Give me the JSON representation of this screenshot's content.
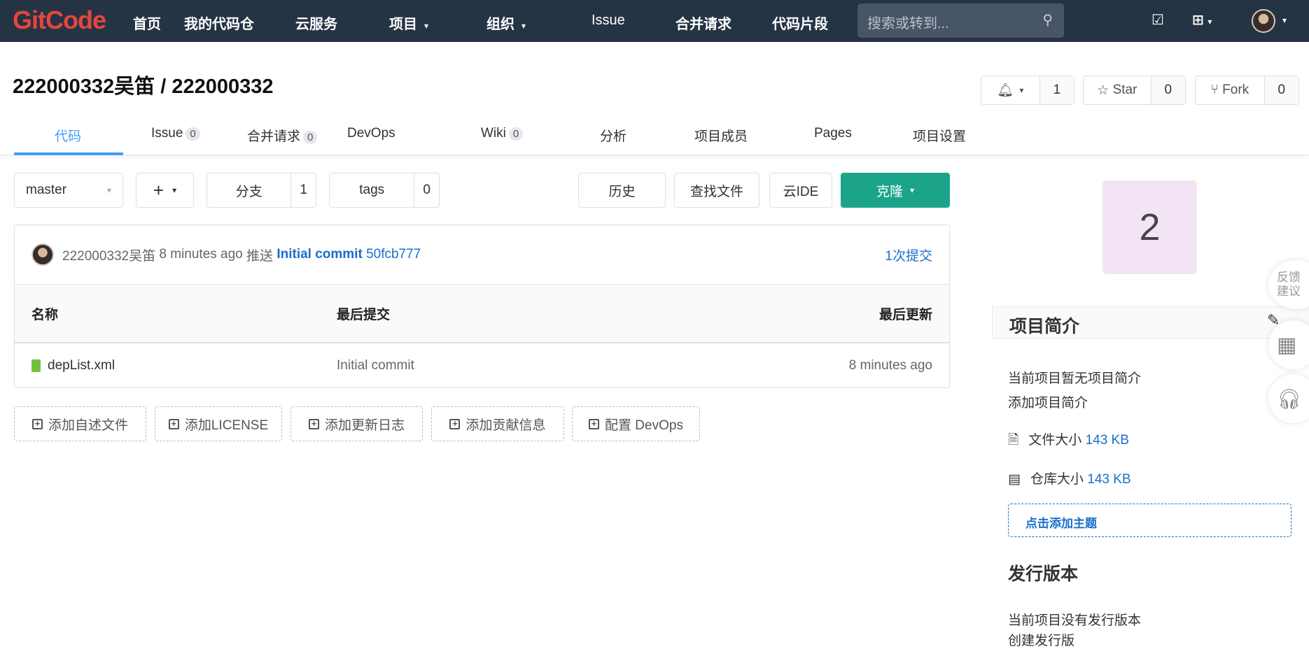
{
  "nav": {
    "logo": "GitCode",
    "items": [
      "首页",
      "我的代码仓",
      "云服务",
      "项目",
      "组织",
      "Issue",
      "合并请求",
      "代码片段"
    ],
    "search_placeholder": "搜索或转到...",
    "caret": "▾"
  },
  "repo": {
    "title": "222000332吴笛 / 222000332",
    "watch_count": "1",
    "star_label": "Star",
    "star_count": "0",
    "fork_label": "Fork",
    "fork_count": "0"
  },
  "tabs": [
    {
      "label": "代码"
    },
    {
      "label": "Issue",
      "badge": "0"
    },
    {
      "label": "合并请求",
      "badge": "0"
    },
    {
      "label": "DevOps"
    },
    {
      "label": "Wiki",
      "badge": "0"
    },
    {
      "label": "分析"
    },
    {
      "label": "项目成员"
    },
    {
      "label": "Pages"
    },
    {
      "label": "项目设置"
    }
  ],
  "toolbar": {
    "branch": "master",
    "add": "+",
    "branches_label": "分支",
    "branches_count": "1",
    "tags_label": "tags",
    "tags_count": "0",
    "history": "历史",
    "find_file": "查找文件",
    "web_ide": "云IDE",
    "clone": "克隆"
  },
  "commit": {
    "author": "222000332吴笛",
    "time": "8 minutes ago",
    "action": "推送",
    "message": "Initial commit",
    "sha": "50fcb777",
    "count": "1次提交"
  },
  "table": {
    "headers": [
      "名称",
      "最后提交",
      "最后更新"
    ],
    "rows": [
      {
        "name": "depList.xml",
        "commit": "Initial commit",
        "updated": "8 minutes ago"
      }
    ]
  },
  "add_buttons": [
    "添加自述文件",
    "添加LICENSE",
    "添加更新日志",
    "添加贡献信息",
    "配置 DevOps"
  ],
  "sidebar": {
    "avatar_letter": "2",
    "intro_title": "项目简介",
    "intro_empty": "当前项目暂无项目简介",
    "add_intro": "添加项目简介",
    "file_size_label": "文件大小",
    "file_size": "143 KB",
    "repo_size_label": "仓库大小",
    "repo_size": "143 KB",
    "add_topic": "点击添加主题",
    "releases_title": "发行版本",
    "releases_empty": "当前项目没有发行版本",
    "create_release": "创建发行版"
  },
  "float": {
    "feedback": "反馈建议"
  },
  "colors": {
    "nav_bg": "#253444",
    "accent": "#409eff",
    "clone": "#1ba48a",
    "link": "#1a6fcb",
    "avatar_bg": "#f2e4f4"
  }
}
